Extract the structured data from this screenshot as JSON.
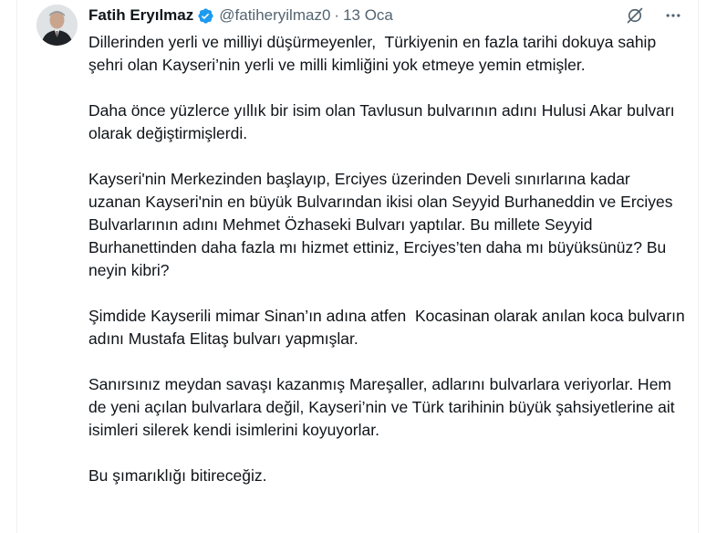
{
  "tweet": {
    "author_name": "Fatih Eryılmaz",
    "handle": "@fatiheryilmaz0",
    "separator": "·",
    "date": "13 Oca",
    "paragraphs": [
      "Dillerinden yerli ve milliyi düşürmeyenler,  Türkiyenin en fazla tarihi dokuya sahip şehri olan Kayseri’nin yerli ve milli kimliğini yok etmeye yemin etmişler.",
      "Daha önce yüzlerce yıllık bir isim olan Tavlusun bulvarının adını Hulusi Akar bulvarı olarak değiştirmişlerdi.",
      "Kayseri'nin Merkezinden başlayıp, Erciyes üzerinden Develi sınırlarına kadar uzanan Kayseri'nin en büyük Bulvarından ikisi olan Seyyid Burhaneddin ve Erciyes Bulvarlarının adını Mehmet Özhaseki Bulvarı yaptılar. Bu millete Seyyid Burhanettinden daha fazla mı hizmet ettiniz, Erciyes’ten daha mı büyüksünüz? Bu neyin kibri?",
      "Şimdide Kayserili mimar Sinan’ın adına atfen  Kocasinan olarak anılan koca bulvarın adını Mustafa Elitaş bulvarı yapmışlar.",
      "Sanırsınız meydan savaşı kazanmış Mareşaller, adlarını bulvarlara veriyorlar. Hem de yeni açılan bulvarlara değil, Kayseri’nin ve Türk tarihinin büyük şahsiyetlerine ait isimleri silerek kendi isimlerini koyuyorlar.",
      "Bu şımarıklığı bitireceğiz."
    ]
  },
  "icons": {
    "verified": "verified-badge-icon",
    "grok": "grok-icon",
    "more": "more-icon"
  },
  "colors": {
    "verified_blue": "#1d9bf0",
    "secondary_text": "#536471",
    "primary_text": "#0f1419"
  }
}
